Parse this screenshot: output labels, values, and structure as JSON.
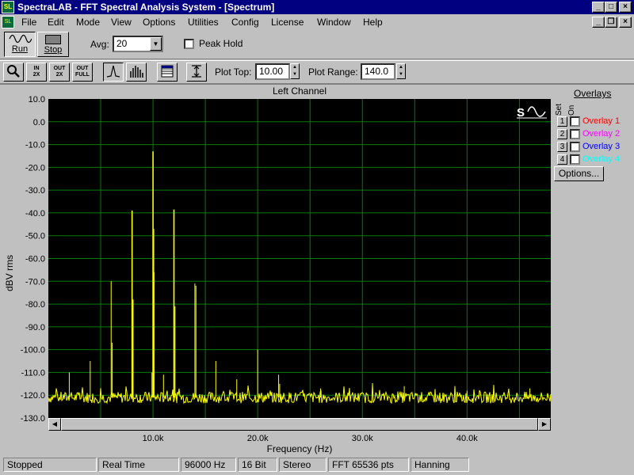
{
  "window": {
    "title": "SpectraLAB - FFT Spectral Analysis System - [Spectrum]",
    "app_icon_text": "SL",
    "buttons": [
      "_",
      "□",
      "×"
    ],
    "mdi_buttons": [
      "_",
      "❐",
      "×"
    ]
  },
  "menu": [
    "File",
    "Edit",
    "Mode",
    "View",
    "Options",
    "Utilities",
    "Config",
    "License",
    "Window",
    "Help"
  ],
  "toolbar": {
    "run_label": "Run",
    "stop_label": "Stop",
    "avg_label": "Avg:",
    "avg_value": "20",
    "peak_hold_label": "Peak Hold",
    "zoom_buttons": [
      {
        "icon": "magnifier-icon",
        "top": "",
        "bottom": ""
      },
      {
        "icon": "zoom-in-icon",
        "top": "IN",
        "bottom": "2X"
      },
      {
        "icon": "zoom-out-icon",
        "top": "OUT",
        "bottom": "2X"
      },
      {
        "icon": "zoom-full-icon",
        "top": "OUT",
        "bottom": "FULL"
      }
    ],
    "plot_top_label": "Plot Top:",
    "plot_top_value": "10.00",
    "plot_range_label": "Plot Range:",
    "plot_range_value": "140.0"
  },
  "overlays": {
    "title": "Overlays",
    "set_header": "Set",
    "on_header": "On",
    "items": [
      {
        "num": "1",
        "label": "Overlay 1",
        "color": "#ff0000"
      },
      {
        "num": "2",
        "label": "Overlay 2",
        "color": "#ff00ff"
      },
      {
        "num": "3",
        "label": "Overlay 3",
        "color": "#0000ff"
      },
      {
        "num": "4",
        "label": "Overlay 4",
        "color": "#00ffff"
      }
    ],
    "options_label": "Options..."
  },
  "status": [
    "Stopped",
    "Real Time",
    "96000 Hz",
    "16 Bit",
    "Stereo",
    "FFT 65536 pts",
    "Hanning"
  ],
  "colors": {
    "plot_bg": "#000000",
    "grid": "#008000",
    "trace": "#ffff00",
    "titlebar": "#000080"
  },
  "chart_data": {
    "type": "line",
    "title": "Left Channel",
    "xlabel": "Frequency (Hz)",
    "ylabel": "dBV rms",
    "xlim": [
      0,
      48000
    ],
    "ylim": [
      -130,
      10
    ],
    "yticks": [
      "10.0",
      "0.0",
      "-10.0",
      "-20.0",
      "-30.0",
      "-40.0",
      "-50.0",
      "-60.0",
      "-70.0",
      "-80.0",
      "-90.0",
      "-100.0",
      "-110.0",
      "-120.0",
      "-130.0"
    ],
    "xticks": [
      {
        "value": 10000,
        "label": "10.0k"
      },
      {
        "value": 20000,
        "label": "20.0k"
      },
      {
        "value": 30000,
        "label": "30.0k"
      },
      {
        "value": 40000,
        "label": "40.0k"
      }
    ],
    "grid": true,
    "noise_floor": -121,
    "peaks": [
      {
        "f": 2000,
        "db": -110
      },
      {
        "f": 4000,
        "db": -105
      },
      {
        "f": 6000,
        "db": -70
      },
      {
        "f": 6100,
        "db": -97
      },
      {
        "f": 8000,
        "db": -39
      },
      {
        "f": 8100,
        "db": -78
      },
      {
        "f": 10000,
        "db": -13
      },
      {
        "f": 10050,
        "db": -47
      },
      {
        "f": 10100,
        "db": -66
      },
      {
        "f": 9900,
        "db": -110
      },
      {
        "f": 11000,
        "db": -111
      },
      {
        "f": 12000,
        "db": -38.5
      },
      {
        "f": 12100,
        "db": -81
      },
      {
        "f": 14000,
        "db": -71
      },
      {
        "f": 14100,
        "db": -72
      },
      {
        "f": 16000,
        "db": -105
      },
      {
        "f": 18000,
        "db": -113
      },
      {
        "f": 20000,
        "db": -100
      },
      {
        "f": 22000,
        "db": -111
      },
      {
        "f": 22100,
        "db": -115
      },
      {
        "f": 26000,
        "db": -117
      },
      {
        "f": 34000,
        "db": -116
      },
      {
        "f": 40000,
        "db": -118
      },
      {
        "f": 46000,
        "db": -117
      }
    ]
  }
}
